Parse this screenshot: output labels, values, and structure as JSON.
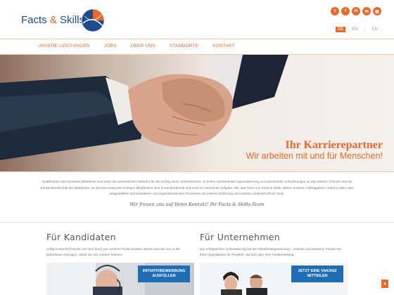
{
  "brand": {
    "name_part1": "Facts",
    "amp": "&",
    "name_part2": "Skills",
    "accent_color": "#e8692b",
    "blue_color": "#1f4b8a"
  },
  "social": [
    {
      "icon": "xing-icon",
      "glyph": "x"
    },
    {
      "icon": "facebook-icon",
      "glyph": "f"
    },
    {
      "icon": "linkedin-icon",
      "glyph": "in"
    },
    {
      "icon": "mail-icon",
      "glyph": "✉"
    },
    {
      "icon": "print-icon",
      "glyph": "▣"
    }
  ],
  "languages": {
    "de": "DE",
    "en": "EN",
    "cn": "CN",
    "active": "DE"
  },
  "nav": {
    "items": [
      "UNSERE LEISTUNGEN",
      "JOBS",
      "ÜBER UNS",
      "STANDORTE",
      "KONTAKT"
    ]
  },
  "hero": {
    "title": "Ihr Karrierepartner",
    "subtitle": "Wir arbeiten mit und für Menschen!"
  },
  "intro": {
    "text": "Qualifizierte und motivierte Mitarbeiter sind einer der wesentlichen Faktoren für den Erfolg eines Unternehmens. In Zeiten zunehmender Spezialisierung und wachsender Anforderungen an das Wissen, Können und die Einsatzbereitschaft der Mitarbeiter, ist das Recruiting des richtigen Mitarbeiters eine herausfordernde und ernst zu nehmende Aufgabe. Wir, das Team von Facts & Skills, stehen unseren Auftraggebern dabei in allen oder ausgewählten administrativen und organisatorischen Prozessen mit unserer Erfahrung und unserer Leidenschaft zur Seite.",
    "signature": "Wir freuen uns auf Ihren Kontakt! Ihr Facts & Skills-Team"
  },
  "candidates": {
    "heading": "Für Kandidaten",
    "text": "Völlig kostenfrei können Sie sich auch von unseren Profis beraten lassen sich bei uns in der Datenbank eintragen, damit wir uns melden können.",
    "cta": "INITIATIVBEWERBUNG AUSFÜLLEN"
  },
  "companies": {
    "heading": "Für Unternehmen",
    "text": "Zur erfolgreichen Unterstützung bei der Mitarbeitergewinnung – zeitnah und passend. Finden Sie Ihren Spezialisten für Projekte, auf Zeit oder eine Festanstellung.",
    "cta": "JETZT EINE VAKANZ MITTEILEN"
  },
  "scroll_top": {
    "icon": "arrow-up-icon",
    "glyph": "▲"
  }
}
